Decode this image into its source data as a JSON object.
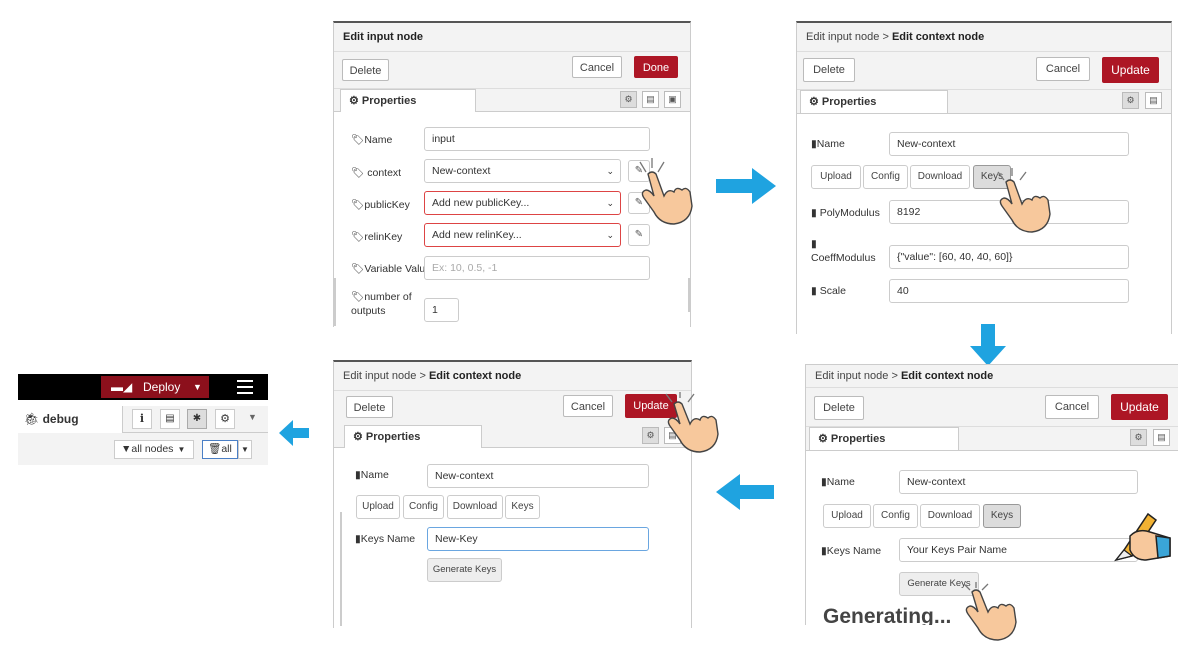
{
  "panel1": {
    "title": "Edit input node",
    "delete": "Delete",
    "cancel": "Cancel",
    "done": "Done",
    "tab": "Properties",
    "fields": {
      "name_label": "Name",
      "name_value": "input",
      "context_label": "context",
      "context_value": "New-context",
      "publickey_label": "publicKey",
      "publickey_value": "Add new publicKey...",
      "relinkey_label": "relinKey",
      "relinkey_value": "Add new relinKey...",
      "variable_label": "Variable Value",
      "variable_placeholder": "Ex: 10, 0.5, -1",
      "outputs_label_1": "number of",
      "outputs_label_2": "outputs",
      "outputs_value": "1"
    }
  },
  "panel2": {
    "breadcrumb": "Edit input node > ",
    "title": "Edit context node",
    "delete": "Delete",
    "cancel": "Cancel",
    "update": "Update",
    "tab": "Properties",
    "name_label": "Name",
    "name_value": "New-context",
    "tabs": [
      "Upload",
      "Config",
      "Download",
      "Keys"
    ],
    "poly_label": "PolyModulus",
    "poly_value": "8192",
    "coeff_label": "CoeffModulus",
    "coeff_value": "{\"value\": [60, 40, 40, 60]}",
    "scale_label": "Scale",
    "scale_value": "40"
  },
  "panel3": {
    "breadcrumb": "Edit input node > ",
    "title": "Edit context node",
    "delete": "Delete",
    "cancel": "Cancel",
    "update": "Update",
    "tab": "Properties",
    "name_label": "Name",
    "name_value": "New-context",
    "tabs": [
      "Upload",
      "Config",
      "Download",
      "Keys"
    ],
    "keys_label": "Keys Name",
    "keys_value": "Your Keys Pair Name",
    "generate": "Generate Keys",
    "status": "Generating..."
  },
  "panel4": {
    "breadcrumb": "Edit input node > ",
    "title": "Edit context node",
    "delete": "Delete",
    "cancel": "Cancel",
    "update": "Update",
    "tab": "Properties",
    "name_label": "Name",
    "name_value": "New-context",
    "tabs": [
      "Upload",
      "Config",
      "Download",
      "Keys"
    ],
    "keys_label": "Keys Name",
    "keys_value": "New-Key",
    "generate": "Generate Keys"
  },
  "panel5": {
    "deploy": "Deploy",
    "debug_tab": "debug",
    "filter_nodes": "all nodes",
    "clear_all": "all"
  },
  "colors": {
    "accent_red": "#ad1625",
    "arrow_blue": "#1fa3e0",
    "header_black": "#000000"
  }
}
